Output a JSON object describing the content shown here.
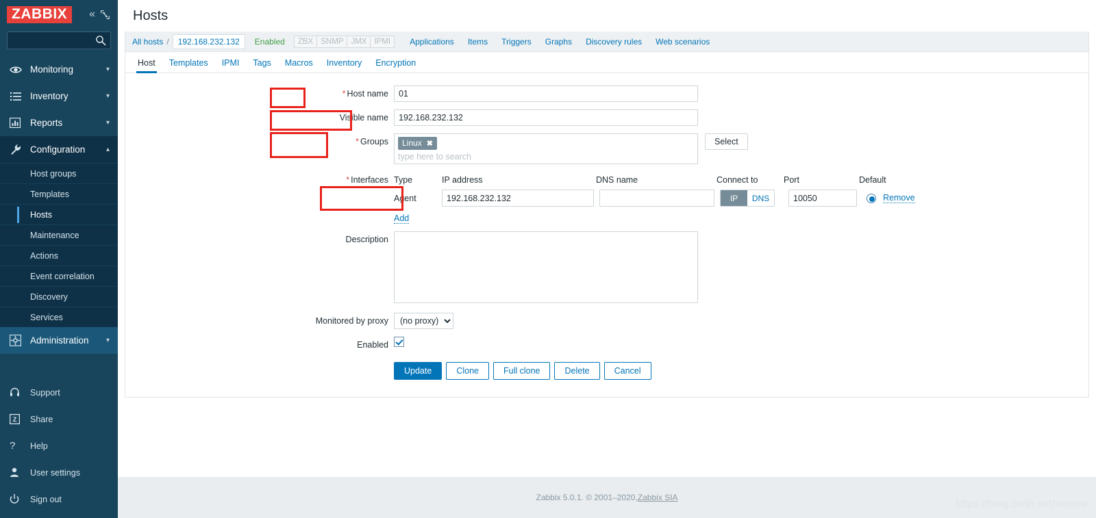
{
  "sidebar": {
    "logo": "ZABBIX",
    "collapse_icon": "chevron-double-left-icon",
    "compact_icon": "compact-view-icon",
    "search": {
      "value": "",
      "placeholder": ""
    },
    "menu": [
      {
        "label": "Monitoring",
        "icon": "eye-icon",
        "expanded": false
      },
      {
        "label": "Inventory",
        "icon": "list-icon",
        "expanded": false
      },
      {
        "label": "Reports",
        "icon": "bar-chart-icon",
        "expanded": false
      },
      {
        "label": "Configuration",
        "icon": "wrench-icon",
        "expanded": true
      },
      {
        "label": "Administration",
        "icon": "gear-icon",
        "expanded": false
      }
    ],
    "configuration_children": [
      {
        "label": "Host groups",
        "selected": false
      },
      {
        "label": "Templates",
        "selected": false
      },
      {
        "label": "Hosts",
        "selected": true
      },
      {
        "label": "Maintenance",
        "selected": false
      },
      {
        "label": "Actions",
        "selected": false
      },
      {
        "label": "Event correlation",
        "selected": false
      },
      {
        "label": "Discovery",
        "selected": false
      },
      {
        "label": "Services",
        "selected": false
      }
    ],
    "bottom": [
      {
        "label": "Support",
        "icon": "headset-icon"
      },
      {
        "label": "Share",
        "icon": "zabbix-share-icon"
      },
      {
        "label": "Help",
        "icon": "question-mark-icon"
      },
      {
        "label": "User settings",
        "icon": "user-icon"
      },
      {
        "label": "Sign out",
        "icon": "power-icon"
      }
    ]
  },
  "header": {
    "title": "Hosts"
  },
  "breadcrumb": {
    "all_hosts": "All hosts",
    "separator": "/",
    "current_host": "192.168.232.132",
    "status": "Enabled",
    "protocols": [
      "ZBX",
      "SNMP",
      "JMX",
      "IPMI"
    ],
    "nav": [
      "Applications",
      "Items",
      "Triggers",
      "Graphs",
      "Discovery rules",
      "Web scenarios"
    ]
  },
  "tabs": [
    {
      "label": "Host",
      "active": true
    },
    {
      "label": "Templates",
      "active": false
    },
    {
      "label": "IPMI",
      "active": false
    },
    {
      "label": "Tags",
      "active": false
    },
    {
      "label": "Macros",
      "active": false
    },
    {
      "label": "Inventory",
      "active": false
    },
    {
      "label": "Encryption",
      "active": false
    }
  ],
  "form": {
    "host_name": {
      "label": "Host name",
      "required": true,
      "value": "01"
    },
    "visible_name": {
      "label": "Visible name",
      "required": false,
      "value": "192.168.232.132"
    },
    "groups": {
      "label": "Groups",
      "required": true,
      "chips": [
        {
          "label": "Linux",
          "remove_icon": "close-icon"
        }
      ],
      "placeholder": "type here to search",
      "select_button": "Select"
    },
    "interfaces": {
      "label": "Interfaces",
      "required": true,
      "columns": [
        "Type",
        "IP address",
        "DNS name",
        "Connect to",
        "Port",
        "Default"
      ],
      "rows": [
        {
          "type": "Agent",
          "ip": "192.168.232.132",
          "dns": "",
          "connect_to": {
            "options": [
              "IP",
              "DNS"
            ],
            "selected": "IP"
          },
          "port": "10050",
          "default_selected": true,
          "remove_label": "Remove"
        }
      ],
      "add_link": "Add"
    },
    "description": {
      "label": "Description",
      "value": ""
    },
    "monitored_by_proxy": {
      "label": "Monitored by proxy",
      "selected": "(no proxy)",
      "options": [
        "(no proxy)"
      ]
    },
    "enabled": {
      "label": "Enabled",
      "checked": true
    }
  },
  "buttons": [
    {
      "label": "Update",
      "style": "primary"
    },
    {
      "label": "Clone",
      "style": "ghost"
    },
    {
      "label": "Full clone",
      "style": "ghost"
    },
    {
      "label": "Delete",
      "style": "ghost"
    },
    {
      "label": "Cancel",
      "style": "ghost"
    }
  ],
  "footer": {
    "text": "Zabbix 5.0.1. © 2001–2020, ",
    "link": "Zabbix SIA",
    "watermark": "https://blog.csdn.net/Insistw"
  },
  "colors": {
    "sidebar_bg": "#18445c",
    "sidebar_sub_bg": "#0e3147",
    "brand_red": "#e8403a",
    "link_blue": "#0275b8",
    "status_green": "#429e47",
    "annotation_red": "#e8221a",
    "chip_gray": "#768d99"
  }
}
